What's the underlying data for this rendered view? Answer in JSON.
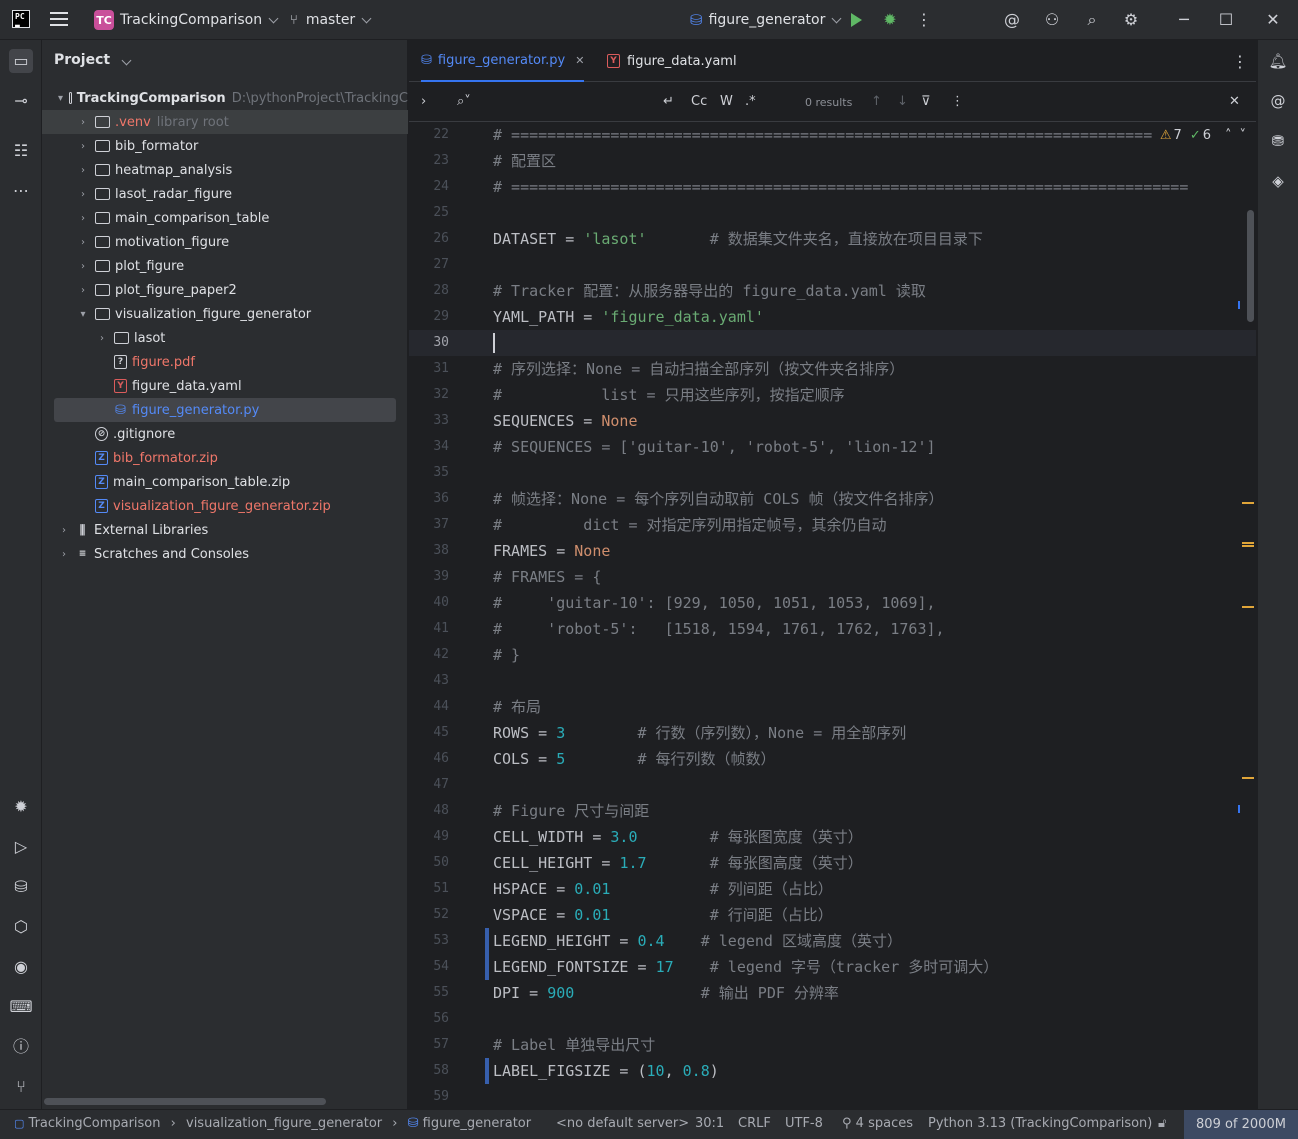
{
  "titlebar": {
    "project_badge": "TC",
    "project_name": "TrackingComparison",
    "branch": "master",
    "run_config": "figure_generator"
  },
  "project_panel": {
    "header": "Project",
    "items": [
      {
        "label": "TrackingComparison",
        "extra": "D:\\pythonProject\\TrackingC",
        "indent": 0,
        "arrow": "▾",
        "icon": "folder",
        "style": "bold"
      },
      {
        "label": ".venv",
        "extra": "library root",
        "indent": 1,
        "arrow": "›",
        "icon": "folder",
        "style": "red",
        "bg": "light"
      },
      {
        "label": "bib_formator",
        "indent": 1,
        "arrow": "›",
        "icon": "folder"
      },
      {
        "label": "heatmap_analysis",
        "indent": 1,
        "arrow": "›",
        "icon": "folder"
      },
      {
        "label": "lasot_radar_figure",
        "indent": 1,
        "arrow": "›",
        "icon": "folder"
      },
      {
        "label": "main_comparison_table",
        "indent": 1,
        "arrow": "›",
        "icon": "folder"
      },
      {
        "label": "motivation_figure",
        "indent": 1,
        "arrow": "›",
        "icon": "folder"
      },
      {
        "label": "plot_figure",
        "indent": 1,
        "arrow": "›",
        "icon": "folder"
      },
      {
        "label": "plot_figure_paper2",
        "indent": 1,
        "arrow": "›",
        "icon": "folder"
      },
      {
        "label": "visualization_figure_generator",
        "indent": 1,
        "arrow": "▾",
        "icon": "folder"
      },
      {
        "label": "lasot",
        "indent": 2,
        "arrow": "›",
        "icon": "folder"
      },
      {
        "label": "figure.pdf",
        "indent": 2,
        "arrow": "",
        "icon": "pdf",
        "style": "red"
      },
      {
        "label": "figure_data.yaml",
        "indent": 2,
        "arrow": "",
        "icon": "yaml"
      },
      {
        "label": "figure_generator.py",
        "indent": 2,
        "arrow": "",
        "icon": "py",
        "style": "blue",
        "bg": "sel"
      },
      {
        "label": ".gitignore",
        "indent": 1,
        "arrow": "",
        "icon": "git"
      },
      {
        "label": "bib_formator.zip",
        "indent": 1,
        "arrow": "",
        "icon": "zip",
        "style": "red"
      },
      {
        "label": "main_comparison_table.zip",
        "indent": 1,
        "arrow": "",
        "icon": "zip"
      },
      {
        "label": "visualization_figure_generator.zip",
        "indent": 1,
        "arrow": "",
        "icon": "zip",
        "style": "red"
      },
      {
        "label": "External Libraries",
        "indent": 0,
        "arrow": "›",
        "icon": "lib"
      },
      {
        "label": "Scratches and Consoles",
        "indent": 0,
        "arrow": "›",
        "icon": "scratch"
      }
    ]
  },
  "tabs": [
    {
      "label": "figure_generator.py",
      "icon": "py",
      "active": true
    },
    {
      "label": "figure_data.yaml",
      "icon": "yaml",
      "active": false
    }
  ],
  "find": {
    "results": "0 results",
    "case": "Cc",
    "words": "W",
    "regex": ".*"
  },
  "inspections": {
    "warnings": "7",
    "ok": "6"
  },
  "editor": {
    "current_line": 30,
    "lines": [
      {
        "n": 22,
        "t": [
          [
            "c-com",
            "# ======================================================================="
          ]
        ]
      },
      {
        "n": 23,
        "t": [
          [
            "c-com",
            "# 配置区"
          ]
        ]
      },
      {
        "n": 24,
        "t": [
          [
            "c-com",
            "# ==========================================================================="
          ]
        ]
      },
      {
        "n": 25,
        "t": []
      },
      {
        "n": 26,
        "t": [
          [
            "",
            "DATASET = "
          ],
          [
            "c-str",
            "'lasot'"
          ],
          [
            "",
            "       "
          ],
          [
            "c-com",
            "# 数据集文件夹名，直接放在项目目录下"
          ]
        ]
      },
      {
        "n": 27,
        "t": []
      },
      {
        "n": 28,
        "t": [
          [
            "c-com",
            "# Tracker 配置：从服务器导出的 figure_data.yaml 读取"
          ]
        ]
      },
      {
        "n": 29,
        "t": [
          [
            "",
            "YAML_PATH = "
          ],
          [
            "c-str",
            "'figure_data.yaml'"
          ]
        ]
      },
      {
        "n": 30,
        "t": []
      },
      {
        "n": 31,
        "t": [
          [
            "c-com",
            "# 序列选择：None = 自动扫描全部序列（按文件夹名排序）"
          ]
        ]
      },
      {
        "n": 32,
        "t": [
          [
            "c-com",
            "#           list = 只用这些序列，按指定顺序"
          ]
        ]
      },
      {
        "n": 33,
        "t": [
          [
            "",
            "SEQUENCES = "
          ],
          [
            "c-kw",
            "None"
          ]
        ]
      },
      {
        "n": 34,
        "t": [
          [
            "c-com",
            "# SEQUENCES = ['guitar-10', 'robot-5', 'lion-12']"
          ]
        ]
      },
      {
        "n": 35,
        "t": []
      },
      {
        "n": 36,
        "t": [
          [
            "c-com",
            "# 帧选择：None = 每个序列自动取前 COLS 帧（按文件名排序）"
          ]
        ]
      },
      {
        "n": 37,
        "t": [
          [
            "c-com",
            "#         dict = 对指定序列用指定帧号，其余仍自动"
          ]
        ]
      },
      {
        "n": 38,
        "t": [
          [
            "",
            "FRAMES = "
          ],
          [
            "c-kw",
            "None"
          ]
        ]
      },
      {
        "n": 39,
        "t": [
          [
            "c-com",
            "# FRAMES = {"
          ]
        ]
      },
      {
        "n": 40,
        "t": [
          [
            "c-com",
            "#     'guitar-10': [929, 1050, 1051, 1053, 1069],"
          ]
        ]
      },
      {
        "n": 41,
        "t": [
          [
            "c-com",
            "#     'robot-5':   [1518, 1594, 1761, 1762, 1763],"
          ]
        ]
      },
      {
        "n": 42,
        "t": [
          [
            "c-com",
            "# }"
          ]
        ]
      },
      {
        "n": 43,
        "t": []
      },
      {
        "n": 44,
        "t": [
          [
            "c-com",
            "# 布局"
          ]
        ]
      },
      {
        "n": 45,
        "t": [
          [
            "",
            "ROWS = "
          ],
          [
            "c-num",
            "3"
          ],
          [
            "",
            "        "
          ],
          [
            "c-com",
            "# 行数（序列数），None = 用全部序列"
          ]
        ]
      },
      {
        "n": 46,
        "t": [
          [
            "",
            "COLS = "
          ],
          [
            "c-num",
            "5"
          ],
          [
            "",
            "        "
          ],
          [
            "c-com",
            "# 每行列数（帧数）"
          ]
        ]
      },
      {
        "n": 47,
        "t": []
      },
      {
        "n": 48,
        "t": [
          [
            "c-com",
            "# Figure 尺寸与间距"
          ]
        ]
      },
      {
        "n": 49,
        "t": [
          [
            "",
            "CELL_WIDTH = "
          ],
          [
            "c-num",
            "3.0"
          ],
          [
            "",
            "        "
          ],
          [
            "c-com",
            "# 每张图宽度（英寸）"
          ]
        ]
      },
      {
        "n": 50,
        "t": [
          [
            "",
            "CELL_HEIGHT = "
          ],
          [
            "c-num",
            "1.7"
          ],
          [
            "",
            "       "
          ],
          [
            "c-com",
            "# 每张图高度（英寸）"
          ]
        ]
      },
      {
        "n": 51,
        "t": [
          [
            "",
            "HSPACE = "
          ],
          [
            "c-num",
            "0.01"
          ],
          [
            "",
            "           "
          ],
          [
            "c-com",
            "# 列间距（占比）"
          ]
        ]
      },
      {
        "n": 52,
        "t": [
          [
            "",
            "VSPACE = "
          ],
          [
            "c-num",
            "0.01"
          ],
          [
            "",
            "           "
          ],
          [
            "c-com",
            "# 行间距（占比）"
          ]
        ]
      },
      {
        "n": 53,
        "t": [
          [
            "",
            "LEGEND_HEIGHT = "
          ],
          [
            "c-num",
            "0.4"
          ],
          [
            "",
            "    "
          ],
          [
            "c-com",
            "# legend 区域高度（英寸）"
          ]
        ],
        "mod": true
      },
      {
        "n": 54,
        "t": [
          [
            "",
            "LEGEND_FONTSIZE = "
          ],
          [
            "c-num",
            "17"
          ],
          [
            "",
            "    "
          ],
          [
            "c-com",
            "# legend 字号（tracker 多时可调大）"
          ]
        ],
        "mod": true
      },
      {
        "n": 55,
        "t": [
          [
            "",
            "DPI = "
          ],
          [
            "c-num",
            "900"
          ],
          [
            "",
            "              "
          ],
          [
            "c-com",
            "# 输出 PDF 分辨率"
          ]
        ]
      },
      {
        "n": 56,
        "t": []
      },
      {
        "n": 57,
        "t": [
          [
            "c-com",
            "# Label 单独导出尺寸"
          ]
        ]
      },
      {
        "n": 58,
        "t": [
          [
            "",
            "LABEL_FIGSIZE = ("
          ],
          [
            "c-num",
            "10"
          ],
          [
            "",
            ", "
          ],
          [
            "c-num",
            "0.8"
          ],
          [
            "",
            ")"
          ]
        ],
        "mod": true
      },
      {
        "n": 59,
        "t": []
      }
    ]
  },
  "statusbar": {
    "crumb1": "TrackingComparison",
    "crumb2": "visualization_figure_generator",
    "crumb3": "figure_generator",
    "server": "<no default server>",
    "position": "30:1",
    "line_sep": "CRLF",
    "encoding": "UTF-8",
    "indent": "4 spaces",
    "interpreter": "Python 3.13 (TrackingComparison)",
    "memory": "809 of 2000M"
  },
  "colors": {
    "accent": "#3574f0",
    "string": "#6aab73",
    "number": "#2aacb8",
    "keyword": "#cf8e6d",
    "comment": "#7a7e85",
    "warning": "#e0a539"
  }
}
